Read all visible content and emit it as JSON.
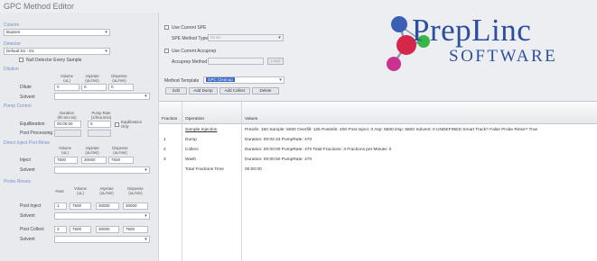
{
  "window": {
    "title": "GPC Method Editor"
  },
  "left": {
    "column_label": "Column",
    "column_value": "Bopsen",
    "detector_label": "Detector",
    "detector_value": "Default D1 - D1",
    "null_detector_label": "Null Detector Every Sample",
    "dilution": {
      "section": "Dilution",
      "headers": [
        "Volume\n(uL)",
        "Aspirate\n(uL/min)",
        "Dispense\n(uL/min)"
      ],
      "row_label": "Dilute",
      "values": [
        "0",
        "0",
        "0"
      ],
      "solvent_label": "Solvent",
      "solvent_value": ""
    },
    "pump": {
      "section": "Pump Control",
      "headers": [
        "Duration\n(hh:mm:ss)",
        "Pump Rate\n(1/h/uL/min)"
      ],
      "equil_label": "Equilibration",
      "equil_values": [
        "00:00:00",
        "0"
      ],
      "equil_only_label": "Equilibration\nOnly",
      "post_label": "Post Processing",
      "post_values": [
        "",
        ""
      ]
    },
    "inject": {
      "section": "Direct Inject Port Rinse",
      "headers": [
        "Volume\n(uL)",
        "Aspirate\n(uL/min)",
        "Dispense\n(uL/min)"
      ],
      "row_label": "Inject",
      "values": [
        "7500",
        "30000",
        "7500"
      ],
      "solvent_label": "Solvent",
      "solvent_value": ""
    },
    "probe": {
      "section": "Probe Rinses",
      "headers": [
        "Pass",
        "Volume\n(uL)",
        "Aspirate\n(uL/min)",
        "Dispense\n(uL/min)"
      ],
      "post_inject_label": "Post Inject",
      "post_inject_values": [
        "1",
        "7500",
        "30000",
        "30000"
      ],
      "solvent_label": "Solvent",
      "post_collect_label": "Post Collect",
      "post_collect_values": [
        "3",
        "7500",
        "30000",
        "7500"
      ],
      "solvent2_label": "Solvent"
    }
  },
  "top": {
    "use_spe_label": "Use Current SPE",
    "spe_type_label": "SPE Method Type",
    "spe_type_value": "Rinse",
    "use_accuprep_label": "Use Current Accuprep",
    "accuprep_label": "Accuprep Method",
    "load_label": "Load",
    "method_template_label": "Method Template",
    "method_template_value": "GPC Cleanup",
    "buttons": [
      "Edit",
      "Add Dump",
      "Add Collect",
      "Delete"
    ]
  },
  "grid": {
    "columns": [
      "Fraction",
      "Operation",
      "Values"
    ],
    "rows": [
      {
        "fraction": "",
        "operation": "Sample Injection",
        "values": "Preinfe: 150 Sample: 5000 Overfill: 125 Postinfe: 400 Post Inject: 0 Asp: 5500 Dsp: 5500 Solvent:    0 UNDEFINED Smart Track? False Probe Rinse? True"
      },
      {
        "fraction": "1",
        "operation": "Dump",
        "values": "Duration: 00:02:43 PumpRate: 470"
      },
      {
        "fraction": "2",
        "operation": "Collect",
        "values": "Duration: 00:00:00 PumpRate: 470 Total Fractions: 3 Fractions per Minute: 0"
      },
      {
        "fraction": "3",
        "operation": "Wash",
        "values": "Duration: 00:00:50 PumpRate: 470"
      },
      {
        "fraction": "",
        "operation": "Total Fractions Time",
        "values": "00:00:00"
      }
    ]
  },
  "logo": {
    "line1": "PrepLinc",
    "line2": "SOFTWARE",
    "colors": {
      "text": "#2b4f9e",
      "ball_blue": "#3a5fb5",
      "ball_red": "#d6264a",
      "ball_green": "#39b54a",
      "ball_magenta": "#c9338f"
    }
  }
}
